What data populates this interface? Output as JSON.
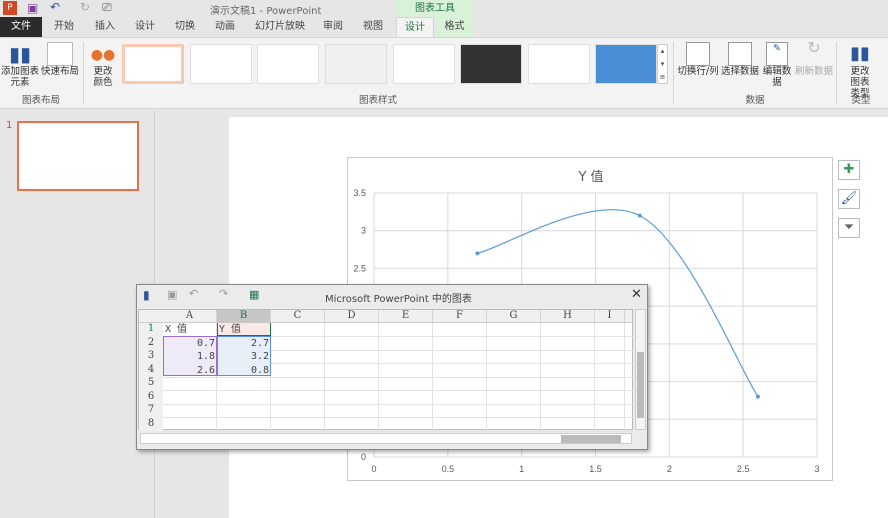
{
  "window": {
    "title": "演示文稿1 - PowerPoint",
    "context_tab_group": "图表工具"
  },
  "tabs": [
    "文件",
    "开始",
    "插入",
    "设计",
    "切换",
    "动画",
    "幻灯片放映",
    "审阅",
    "视图",
    "设计",
    "格式"
  ],
  "ribbon": {
    "chart_layouts": {
      "label": "图表布局",
      "add_element": "添加图表元素",
      "quick_layout": "快速布局"
    },
    "chart_styles": {
      "label": "图表样式",
      "change_colors": "更改颜色"
    },
    "data": {
      "label": "数据",
      "switch": "切换行/列",
      "select": "选择数据",
      "edit": "编辑数据",
      "refresh": "刷新数据"
    },
    "type": {
      "label": "类型",
      "change_type": "更改图表类型"
    }
  },
  "slides": [
    {
      "number": "1"
    }
  ],
  "chart": {
    "title": "Y 值"
  },
  "chart_data": {
    "type": "scatter",
    "title": "Y 值",
    "smooth": true,
    "x": [
      0.7,
      1.8,
      2.6
    ],
    "y": [
      2.7,
      3.2,
      0.8
    ],
    "xlim": [
      0,
      3
    ],
    "ylim": [
      0,
      3.5
    ],
    "x_ticks": [
      "0",
      "0.5",
      "1",
      "1.5",
      "2",
      "2.5",
      "3"
    ],
    "y_ticks": [
      "0",
      "0.5",
      "1",
      "1.5",
      "2",
      "2.5",
      "3",
      "3.5"
    ],
    "grid": true,
    "color": "#5b9bd5"
  },
  "data_window": {
    "title": "Microsoft PowerPoint 中的图表",
    "columns": [
      "A",
      "B",
      "C",
      "D",
      "E",
      "F",
      "G",
      "H",
      "I"
    ],
    "rows": [
      "1",
      "2",
      "3",
      "4",
      "5",
      "6",
      "7",
      "8"
    ],
    "cells": [
      [
        "X 值",
        "Y 值"
      ],
      [
        "0.7",
        "2.7"
      ],
      [
        "1.8",
        "3.2"
      ],
      [
        "2.6",
        "0.8"
      ]
    ]
  }
}
